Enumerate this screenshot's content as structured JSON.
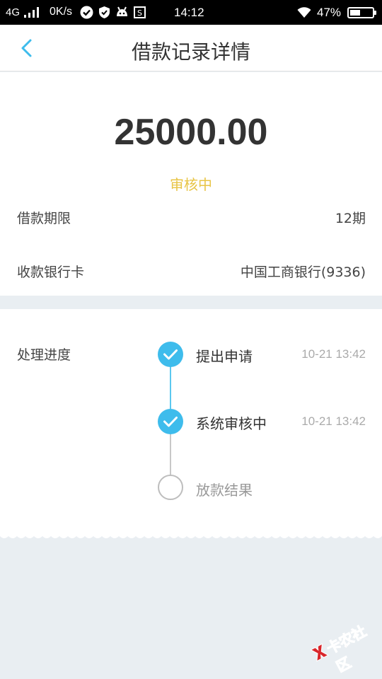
{
  "status_bar": {
    "network": "4G",
    "speed": "0K/s",
    "time": "14:12",
    "battery": "47%",
    "battery_level": 0.47,
    "icons": [
      "check-circle-icon",
      "shield-icon",
      "android-icon",
      "screenshot-icon"
    ]
  },
  "header": {
    "title": "借款记录详情",
    "back_icon": "chevron-left-icon"
  },
  "loan": {
    "amount": "25000.00",
    "status": "审核中",
    "term_label": "借款期限",
    "term_value": "12期",
    "bank_label": "收款银行卡",
    "bank_value": "中国工商银行(9336)"
  },
  "progress": {
    "label": "处理进度",
    "steps": [
      {
        "name": "提出申请",
        "time": "10-21 13:42",
        "done": true
      },
      {
        "name": "系统审核中",
        "time": "10-21 13:42",
        "done": true
      },
      {
        "name": "放款结果",
        "time": "",
        "done": false
      }
    ]
  },
  "watermark": {
    "text": "卡农社区"
  },
  "colors": {
    "accent": "#3ebcec",
    "status": "#e8c547",
    "background": "#e9eef2",
    "watermark": "#d9262b"
  }
}
